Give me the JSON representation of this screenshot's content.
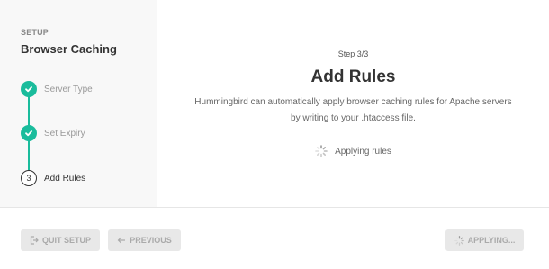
{
  "sidebar": {
    "eyebrow": "SETUP",
    "title": "Browser Caching",
    "steps": [
      {
        "label": "Server Type",
        "state": "done"
      },
      {
        "label": "Set Expiry",
        "state": "done"
      },
      {
        "number": "3",
        "label": "Add Rules",
        "state": "current"
      }
    ]
  },
  "main": {
    "step_count": "Step 3/3",
    "heading": "Add Rules",
    "description": "Hummingbird can automatically apply browser caching rules for Apache servers by writing to your .htaccess file.",
    "status": "Applying rules"
  },
  "footer": {
    "quit_label": "QUIT SETUP",
    "previous_label": "PREVIOUS",
    "applying_label": "APPLYING..."
  },
  "icons": {
    "check": "check-icon",
    "spinner": "spinner-icon",
    "quit": "exit-icon",
    "previous": "arrow-left-icon"
  },
  "colors": {
    "accent": "#1abc9c",
    "sidebar_bg": "#f8f8f8",
    "button_bg": "#e8e8e8"
  }
}
